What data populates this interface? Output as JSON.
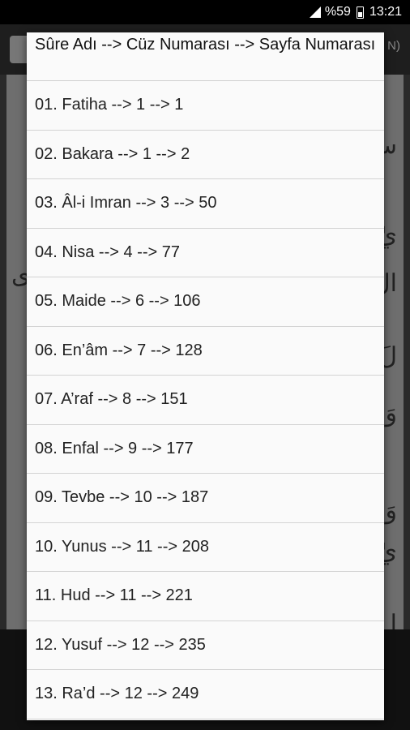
{
  "status_bar": {
    "battery": "%59",
    "time": "13:21"
  },
  "background_app": {
    "toolbar_right_text": "N)"
  },
  "dialog": {
    "title": "Sûre Adı --> Cüz Numarası --> Sayfa Numarası",
    "items": [
      {
        "label": "01. Fatiha --> 1 --> 1"
      },
      {
        "label": "02. Bakara --> 1 --> 2"
      },
      {
        "label": "03. Âl-i Imran --> 3 --> 50"
      },
      {
        "label": "04. Nisa --> 4 --> 77"
      },
      {
        "label": "05. Maide --> 6 --> 106"
      },
      {
        "label": "06. En’âm --> 7 --> 128"
      },
      {
        "label": "07. A’raf --> 8 --> 151"
      },
      {
        "label": "08. Enfal --> 9 --> 177"
      },
      {
        "label": "09. Tevbe --> 10 --> 187"
      },
      {
        "label": "10. Yunus --> 11 --> 208"
      },
      {
        "label": "11. Hud --> 11 --> 221"
      },
      {
        "label": "12. Yusuf --> 12 --> 235"
      },
      {
        "label": "13. Ra’d --> 12 --> 249"
      }
    ]
  },
  "colors": {
    "dialog_bg": "#fafafa",
    "divider": "#d3d3d3",
    "dim_bg": "#2a2a2a"
  }
}
